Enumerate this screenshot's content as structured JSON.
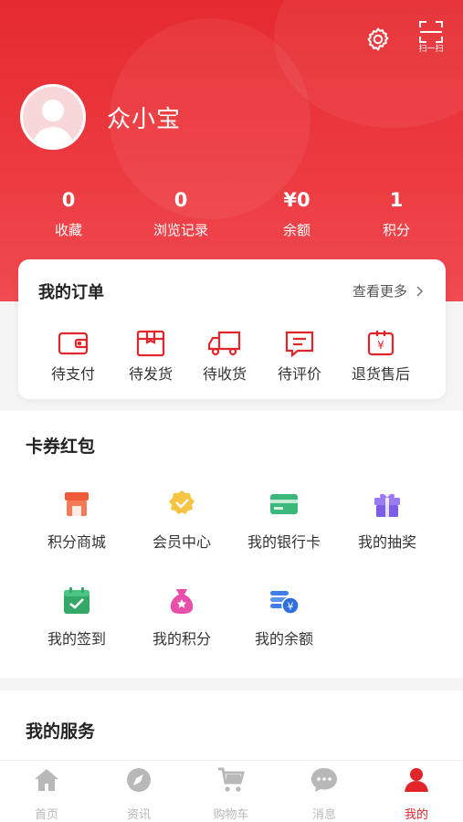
{
  "header": {
    "scan_label": "扫一扫"
  },
  "profile": {
    "username": "众小宝"
  },
  "stats": [
    {
      "value": "0",
      "label": "收藏"
    },
    {
      "value": "0",
      "label": "浏览记录"
    },
    {
      "value": "¥0",
      "label": "余额"
    },
    {
      "value": "1",
      "label": "积分"
    }
  ],
  "orders": {
    "title": "我的订单",
    "more": "查看更多",
    "items": [
      {
        "label": "待支付",
        "icon": "wallet-icon"
      },
      {
        "label": "待发货",
        "icon": "package-icon"
      },
      {
        "label": "待收货",
        "icon": "truck-icon"
      },
      {
        "label": "待评价",
        "icon": "comment-icon"
      },
      {
        "label": "退货售后",
        "icon": "refund-icon"
      }
    ]
  },
  "coupons": {
    "title": "卡券红包",
    "items": [
      {
        "label": "积分商城",
        "icon": "store-icon"
      },
      {
        "label": "会员中心",
        "icon": "member-badge-icon"
      },
      {
        "label": "我的银行卡",
        "icon": "bank-card-icon"
      },
      {
        "label": "我的抽奖",
        "icon": "gift-icon"
      },
      {
        "label": "我的签到",
        "icon": "calendar-check-icon"
      },
      {
        "label": "我的积分",
        "icon": "money-bag-icon"
      },
      {
        "label": "我的余额",
        "icon": "coins-icon"
      }
    ]
  },
  "services": {
    "title": "我的服务"
  },
  "tabbar": {
    "items": [
      {
        "label": "首页",
        "icon": "home-icon"
      },
      {
        "label": "资讯",
        "icon": "compass-icon"
      },
      {
        "label": "购物车",
        "icon": "cart-icon"
      },
      {
        "label": "消息",
        "icon": "message-icon"
      },
      {
        "label": "我的",
        "icon": "user-icon"
      }
    ],
    "active": "我的"
  },
  "colors": {
    "brand": "#e52a30",
    "order_icon": "#e2242b",
    "tab_inactive": "#b8b8b8"
  }
}
